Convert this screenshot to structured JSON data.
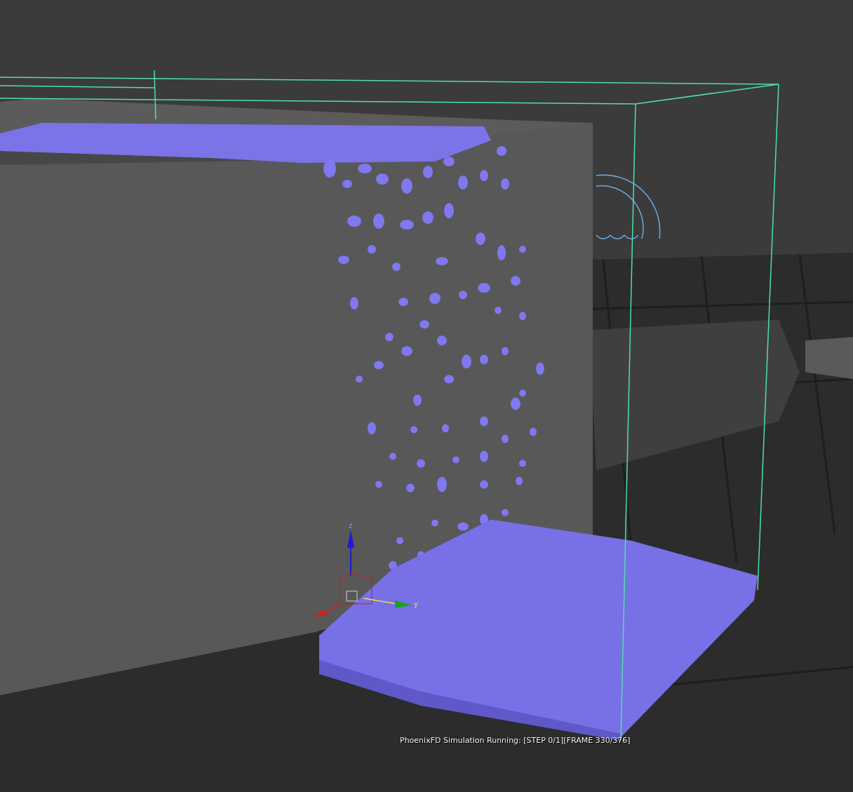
{
  "viewport": {
    "status_text": "PhoenixFD Simulation Running: [STEP 0/1][FRAME 330/376]",
    "gizmo": {
      "axis_labels": [
        "z",
        "y"
      ]
    }
  }
}
